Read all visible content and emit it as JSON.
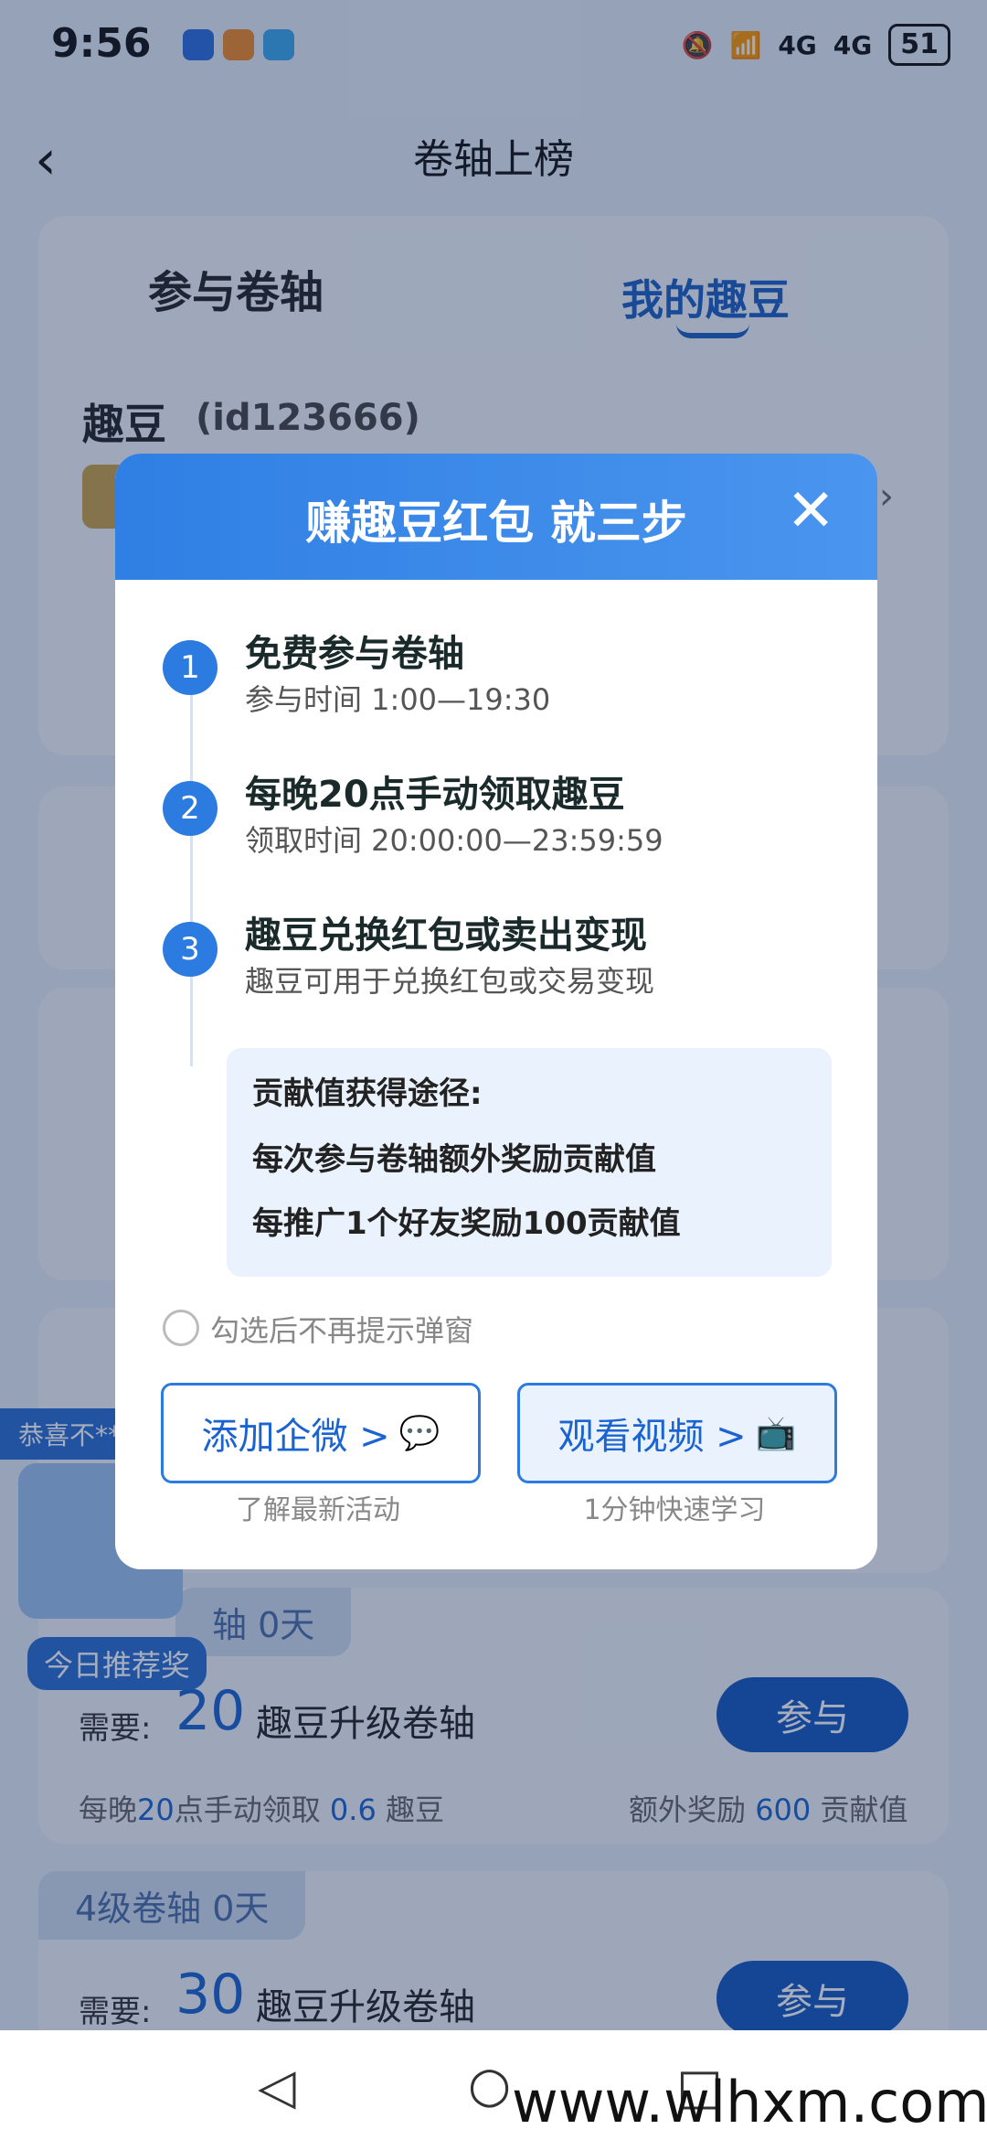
{
  "status": {
    "time": "9:56",
    "signal1": "4G",
    "signal2": "4G",
    "battery": "51"
  },
  "header": {
    "title": "卷轴上榜"
  },
  "tabs": {
    "join": "参与卷轴",
    "mine": "我的趣豆"
  },
  "user": {
    "name": "趣豆",
    "id": "(id123666)"
  },
  "float": {
    "congrats": "恭喜不**",
    "label": "今日推荐奖"
  },
  "cards": {
    "level3": {
      "tag": "轴 0天",
      "need_label": "需要:",
      "amount": "20",
      "amount_text": "趣豆升级卷轴",
      "join": "参与",
      "daily_prefix": "每晚",
      "daily_hour": "20",
      "daily_mid": "点手动领取",
      "daily_beans": "0.6",
      "daily_unit": "趣豆",
      "bonus_prefix": "额外奖励",
      "bonus_value": "600",
      "bonus_unit": "贡献值"
    },
    "level4": {
      "tag": "4级卷轴 0天",
      "need_label": "需要:",
      "amount": "30",
      "amount_text": "趣豆升级卷轴",
      "join": "参与"
    }
  },
  "modal": {
    "title": "赚趣豆红包 就三步",
    "steps": [
      {
        "num": "1",
        "title": "免费参与卷轴",
        "sub": "参与时间 1:00—19:30"
      },
      {
        "num": "2",
        "title": "每晚20点手动领取趣豆",
        "sub": "领取时间 20:00:00—23:59:59"
      },
      {
        "num": "3",
        "title": "趣豆兑换红包或卖出变现",
        "sub": "趣豆可用于兑换红包或交易变现"
      }
    ],
    "box": {
      "title": "贡献值获得途径:",
      "line1": "每次参与卷轴额外奖励贡献值",
      "line2": "每推广1个好友奖励100贡献值"
    },
    "checkbox_label": "勾选后不再提示弹窗",
    "btn_wechat": "添加企微 >",
    "btn_wechat_sub": "了解最新活动",
    "btn_video": "观看视频 >",
    "btn_video_sub": "1分钟快速学习"
  },
  "watermark": "www.wlhxm.com"
}
